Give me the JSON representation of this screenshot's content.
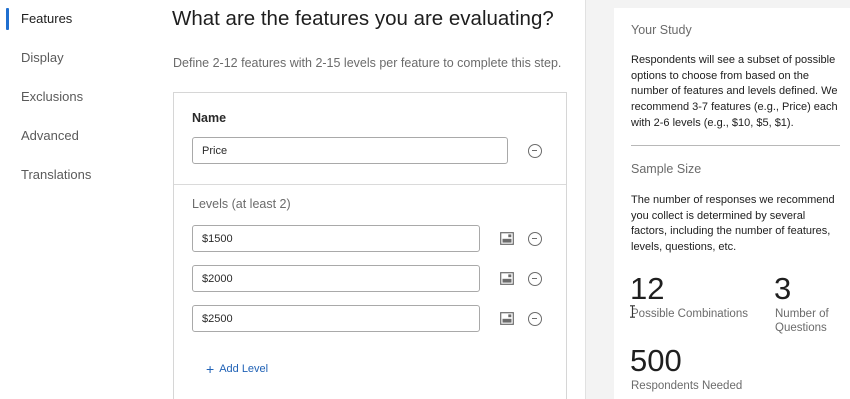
{
  "nav": {
    "items": [
      {
        "label": "Features",
        "active": true
      },
      {
        "label": "Display",
        "active": false
      },
      {
        "label": "Exclusions",
        "active": false
      },
      {
        "label": "Advanced",
        "active": false
      },
      {
        "label": "Translations",
        "active": false
      }
    ]
  },
  "main": {
    "title": "What are the features you are evaluating?",
    "subtitle": "Define 2-12 features with 2-15 levels per feature to complete this step.",
    "feature": {
      "name_label": "Name",
      "name_value": "Price",
      "levels_label": "Levels (at least 2)",
      "levels": [
        "$1500",
        "$2000",
        "$2500"
      ],
      "add_level_label": "Add Level"
    }
  },
  "study": {
    "title": "Your Study",
    "text": "Respondents will see a subset of possible options to choose from based on the number of features and levels defined. We recommend 3-7 features (e.g., Price) each with 2-6 levels (e.g., $10, $5, $1).",
    "sample_title": "Sample Size",
    "sample_text": "The number of responses we recommend you collect is determined by several factors, including the number of features, levels, questions, etc.",
    "combinations_value": "12",
    "combinations_label": "Possible Combinations",
    "questions_value": "3",
    "questions_label": "Number of Questions",
    "respondents_value": "500",
    "respondents_label": "Respondents Needed"
  },
  "colors": {
    "accent": "#1f6fd0",
    "link": "#2062b6",
    "panel_bg": "#f3f3f3"
  },
  "icons": [
    "minus-circle-icon",
    "image-icon",
    "plus-icon",
    "text-cursor-icon"
  ]
}
